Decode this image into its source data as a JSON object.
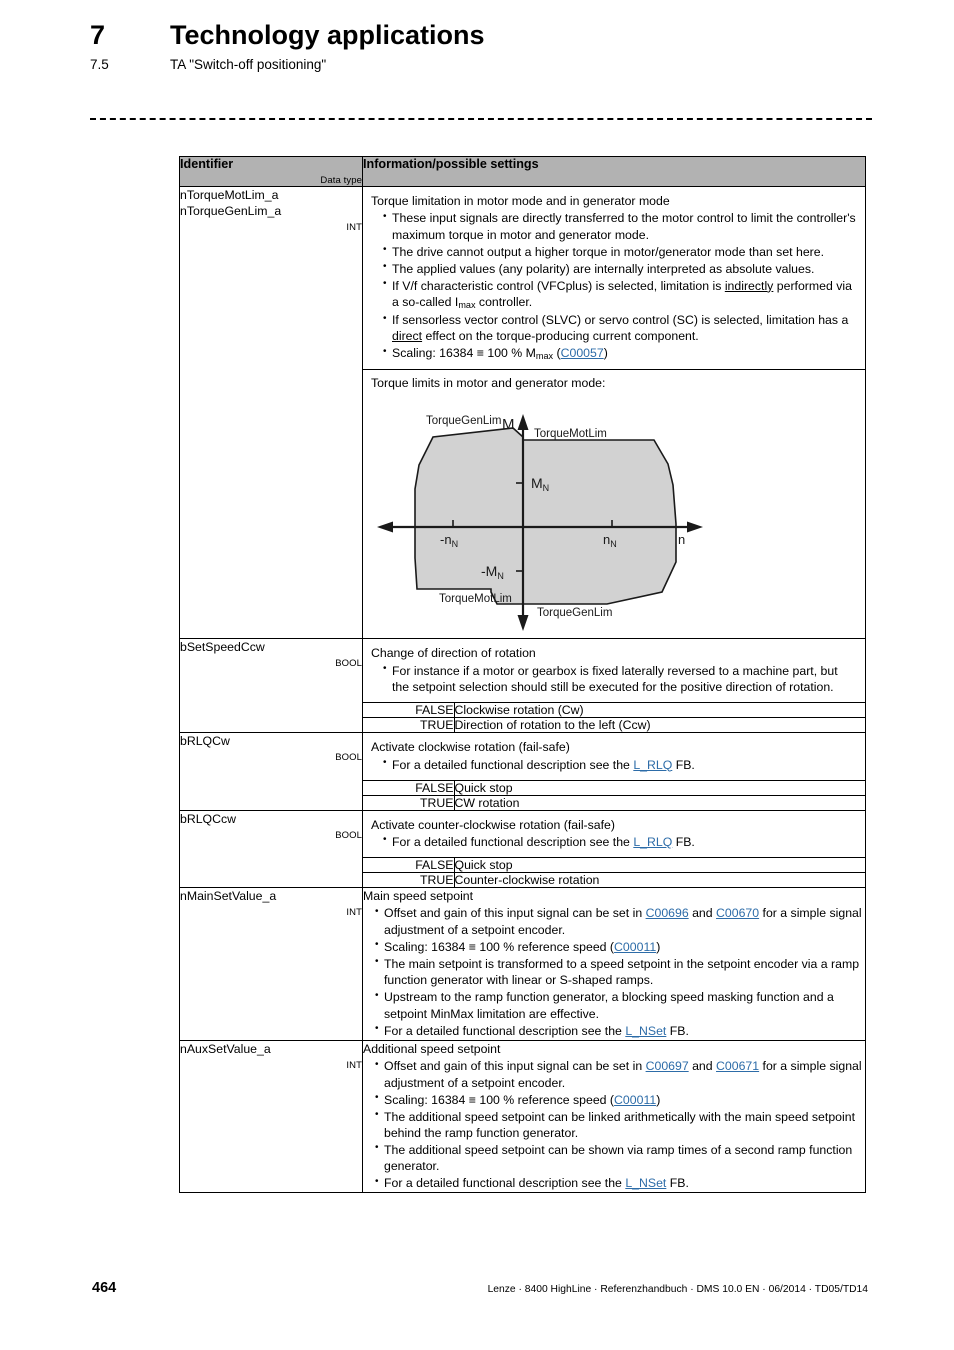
{
  "header": {
    "chapter_number": "7",
    "chapter_title": "Technology applications",
    "section_number": "7.5",
    "section_title": "TA \"Switch-off positioning\""
  },
  "table": {
    "headers": {
      "identifier": "Identifier",
      "data_type_sublabel": "Data type",
      "information": "Information/possible settings"
    },
    "rows": [
      {
        "id": "ntorquelim",
        "identifier_lines": [
          "nTorqueMotLim_a",
          "nTorqueGenLim_a"
        ],
        "data_type": "INT",
        "title": "Torque limitation in motor mode and in generator mode",
        "bullets": [
          "These input signals are directly transferred to the motor control to limit the controller's maximum torque in motor and generator mode.",
          "The drive cannot output a higher torque in motor/generator mode than set here.",
          "The applied values (any polarity) are internally interpreted as absolute values.",
          "If V/f characteristic control (VFCplus) is selected, limitation is indirectly performed via a so-called Imax controller.",
          "If sensorless vector control (SLVC) or servo control (SC) is selected, limitation has a direct effect on the torque-producing current component.",
          "Scaling: 16384 ≡ 100 % Mmax (C00057)"
        ],
        "diagram_caption": "Torque limits in motor and generator mode:"
      },
      {
        "id": "bsetspeedccw",
        "identifier_lines": [
          "bSetSpeedCcw"
        ],
        "data_type": "BOOL",
        "title": "Change of direction of rotation",
        "bullets": [
          "For instance if a motor or gearbox is fixed laterally reversed to a machine part, but the setpoint selection should still be executed for the positive direction of rotation."
        ],
        "bool_table": [
          {
            "state": "FALSE",
            "description": "Clockwise rotation (Cw)"
          },
          {
            "state": "TRUE",
            "description": "Direction of rotation to the left (Ccw)"
          }
        ]
      },
      {
        "id": "brlqcw",
        "identifier_lines": [
          "bRLQCw"
        ],
        "data_type": "BOOL",
        "title": "Activate clockwise rotation (fail-safe)",
        "bullets_rich": [
          {
            "pre": "For a detailed functional description see the ",
            "link": "L_RLQ",
            "post": " FB."
          }
        ],
        "bool_table": [
          {
            "state": "FALSE",
            "description": "Quick stop"
          },
          {
            "state": "TRUE",
            "description": "CW rotation"
          }
        ]
      },
      {
        "id": "brlqccw",
        "identifier_lines": [
          "bRLQCcw"
        ],
        "data_type": "BOOL",
        "title": "Activate counter-clockwise rotation (fail-safe)",
        "bullets_rich": [
          {
            "pre": "For a detailed functional description see the ",
            "link": "L_RLQ",
            "post": " FB."
          }
        ],
        "bool_table": [
          {
            "state": "FALSE",
            "description": "Quick stop"
          },
          {
            "state": "TRUE",
            "description": "Counter-clockwise rotation"
          }
        ]
      },
      {
        "id": "nmainsetvalue",
        "identifier_lines": [
          "nMainSetValue_a"
        ],
        "data_type": "INT",
        "title": "Main speed setpoint",
        "bullets": [
          "Offset and gain of this input signal can be set in C00696 and C00670 for a simple signal adjustment of a setpoint encoder.",
          "Scaling: 16384 ≡ 100 % reference speed (C00011)",
          "The main setpoint is transformed to a speed setpoint in the setpoint encoder via a ramp function generator with linear or S-shaped ramps.",
          "Upstream to the ramp function generator, a blocking speed masking function and a setpoint MinMax limitation are effective.",
          "For a detailed functional description see the L_NSet FB."
        ]
      },
      {
        "id": "nauxsetvalue",
        "identifier_lines": [
          "nAuxSetValue_a"
        ],
        "data_type": "INT",
        "title": "Additional speed setpoint",
        "bullets": [
          "Offset and gain of this input signal can be set in C00697 and C00671 for a simple signal adjustment of a setpoint encoder.",
          "Scaling: 16384 ≡ 100 % reference speed (C00011)",
          "The additional speed setpoint can be linked arithmetically with the main speed setpoint behind the ramp function generator.",
          "The additional speed setpoint can be shown via ramp times of a second ramp function generator.",
          "For a detailed functional description see the L_NSet FB."
        ]
      }
    ]
  },
  "diagram": {
    "caption": "Torque limits in motor and generator mode:",
    "axis_label_y": "M",
    "axis_label_x": "n",
    "tick_labels": {
      "m_pos": "M",
      "m_pos_sub": "N",
      "m_neg": "-M",
      "m_neg_sub": "N",
      "n_pos": "n",
      "n_pos_sub": "N",
      "n_neg": "-n",
      "n_neg_sub": "N"
    },
    "region_labels": {
      "top_left": "TorqueGenLim",
      "top_right": "TorqueMotLim",
      "bottom_left": "TorqueMotLim",
      "bottom_right": "TorqueGenLim"
    },
    "fill_color": "#d2d2d2",
    "stroke_color": "#1a1a1a"
  },
  "links": {
    "c00057": "C00057",
    "c00011": "C00011",
    "c00696": "C00696",
    "c00670": "C00670",
    "c00697": "C00697",
    "c00671": "C00671",
    "l_rlq": "L_RLQ",
    "l_nset": "L_NSet"
  },
  "footer": {
    "page_number": "464",
    "note": "Lenze · 8400 HighLine · Referenzhandbuch · DMS 10.0 EN · 06/2014 · TD05/TD14"
  }
}
